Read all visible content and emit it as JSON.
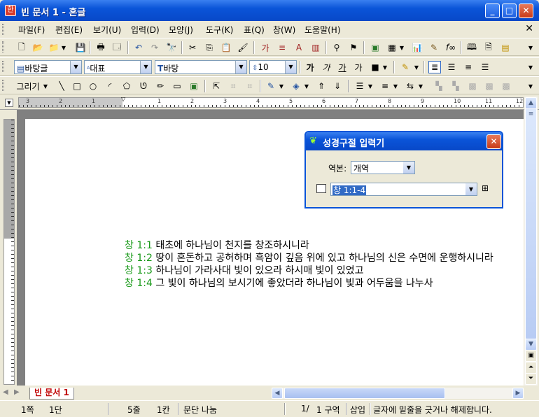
{
  "window": {
    "title": "빈 문서 1 - 혼글",
    "app_icon": "한"
  },
  "title_buttons": {
    "minimize": "_",
    "maximize": "□",
    "close": "✕"
  },
  "menu": [
    "파일(F)",
    "편집(E)",
    "보기(U)",
    "입력(D)",
    "모양(J)",
    "도구(K)",
    "표(Q)",
    "창(W)",
    "도움말(H)"
  ],
  "menu_close": "✕",
  "format_bar": {
    "font_lang": "바탕글",
    "style": "대표",
    "font": "바탕",
    "size": "10",
    "bold": "가",
    "italic": "가",
    "underline": "가",
    "other": "가"
  },
  "draw_bar": {
    "label": "그리기"
  },
  "ruler_numbers": [
    "3",
    "2",
    "1",
    "1",
    "2",
    "3",
    "4",
    "5",
    "6",
    "7",
    "8",
    "9",
    "10",
    "11",
    "12"
  ],
  "document": {
    "lines": [
      {
        "ref": "창 1:1",
        "text": "태초에 하나님이 천지를 창조하시니라"
      },
      {
        "ref": "창 1:2",
        "text": "땅이 혼돈하고 공허하며 흑암이 깊음 위에 있고 하나님의 신은 수면에 운행하시니라"
      },
      {
        "ref": "창 1:3",
        "text": "하나님이 가라사대 빛이 있으라 하시매 빛이 있었고"
      },
      {
        "ref": "창 1:4",
        "text": "그 빛이 하나님의 보시기에 좋았더라 하나님이 빛과 어두움을 나누사"
      }
    ]
  },
  "dialog": {
    "title": "성경구절 입력기",
    "version_label": "역본:",
    "version_value": "개역",
    "reference_value": "창 1:1-4"
  },
  "tab": {
    "label": "빈 문서 1"
  },
  "status": {
    "page": "1쪽",
    "column": "1단",
    "line": "5줄",
    "col_pos": "1칸",
    "para_split": "문단 나눔",
    "section_frac": "1/",
    "section": "1 구역",
    "mode": "삽입",
    "message": "글자에 밑줄을 긋거나 해제합니다."
  },
  "colors": {
    "title_blue": "#0a54d8",
    "ref_green": "#1a9a1a",
    "tab_red": "#c00000",
    "selection": "#316ac5"
  }
}
